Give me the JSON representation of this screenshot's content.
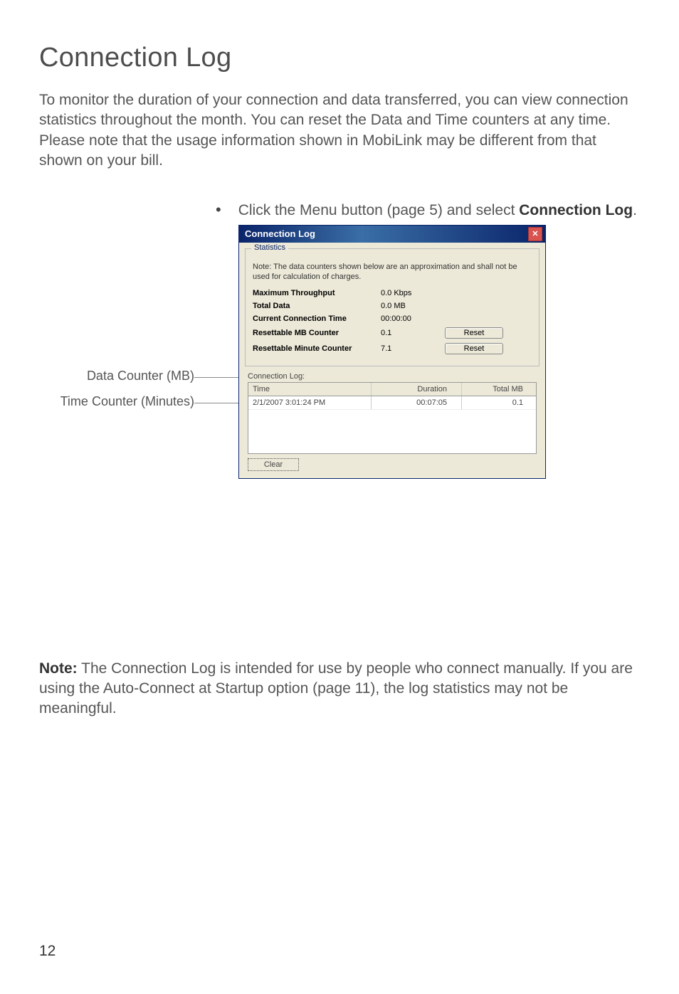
{
  "heading": "Connection Log",
  "intro": "To monitor the duration of your connection and data transferred, you can view connection statistics throughout the month. You can reset the Data and Time counters at any time. Please note that the usage information shown in MobiLink may be different from that shown on your bill.",
  "bullet": {
    "lead": "Click the Menu button (page 5) and select ",
    "bold": "Connection Log",
    "tail": "."
  },
  "labels": {
    "mb": "Data Counter (MB)",
    "min": "Time Counter (Minutes)"
  },
  "dialog": {
    "title": "Connection Log",
    "group_legend": "Statistics",
    "note": "Note: The data counters shown below are an approximation and shall not be used for calculation of charges.",
    "stats": {
      "max_throughput": {
        "label": "Maximum Throughput",
        "value": "0.0 Kbps"
      },
      "total_data": {
        "label": "Total Data",
        "value": "0.0 MB"
      },
      "conn_time": {
        "label": "Current Connection Time",
        "value": "00:00:00"
      },
      "mb_counter": {
        "label": "Resettable MB Counter",
        "value": "0.1"
      },
      "min_counter": {
        "label": "Resettable Minute Counter",
        "value": "7.1"
      }
    },
    "reset_label": "Reset",
    "log_label": "Connection Log:",
    "columns": {
      "time": "Time",
      "dur": "Duration",
      "mb": "Total MB"
    },
    "rows": [
      {
        "time": "2/1/2007 3:01:24 PM",
        "dur": "00:07:05",
        "mb": "0.1"
      }
    ],
    "clear": "Clear"
  },
  "note_para": {
    "bold": "Note:",
    "text": " The Connection Log is intended for use by people who connect manually. If you are using the Auto-Connect at Startup option (page 11), the log statistics may not be meaningful."
  },
  "page_number": "12"
}
